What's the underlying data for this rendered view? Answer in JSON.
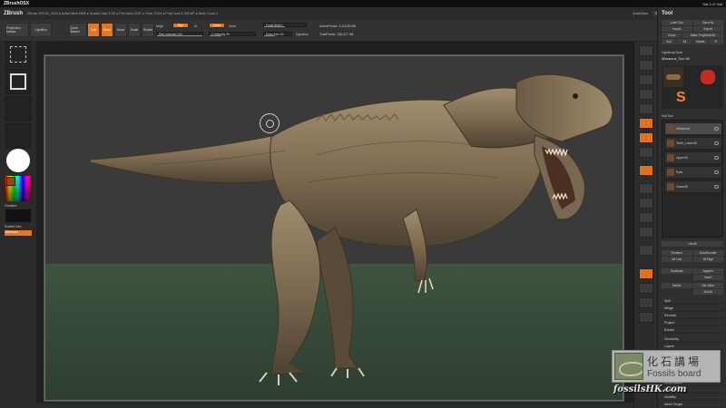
{
  "menubar": {
    "app": "ZBrushOSX",
    "clock": "Sat 2:47 AM"
  },
  "zmenu": {
    "brand": "ZBrush",
    "info": "ZBrush 4R6   Dz_1043   ● Active Mem 6958 ● Scratch Disk 3726 ● Free Mem 2257 ● Timer 0.004 ● PolyCount 4.788 MP ● Mesh Count 1",
    "quicksave": "QuickSave",
    "seethrough": "See-through 0",
    "menus": "Menus",
    "script": "DefaultZScript"
  },
  "shelf": {
    "projection_master": "Projection Master",
    "lightbox": "LightBox",
    "quick_sketch": "Quick Sketch",
    "edit": "Edit",
    "draw": "Draw",
    "move": "Move",
    "scale": "Scale",
    "rotate": "Rotate",
    "mrgb": "Mrgb",
    "rgb": "Rgb",
    "m": "M",
    "rgb_intensity": "Rgb Intensity 100",
    "zadd": "Zadd",
    "zsub": "Zsub",
    "z_intensity": "Z Intensity 25",
    "focal_shift": "Focal Shift 0",
    "draw_size": "Draw Size 64",
    "dynamic": "Dynamic",
    "active_points": "ActivePoints: 2,118,85 Mil",
    "total_points": "TotalPoints: 138,417 Mil"
  },
  "left": {
    "gradient": "Gradient",
    "switch_color": "SwitchColor",
    "alternate": "Alternate"
  },
  "palette": {
    "title": "Tool",
    "load_tool": "Load Tool",
    "save_as": "Save As",
    "import": "Import",
    "export": "Export",
    "clone": "Clone",
    "make_polymesh": "Make PolyMesh3D",
    "goz": "GoZ",
    "all": "All",
    "visible": "Visible",
    "r": "R",
    "lightbox_tools": "Lightbox▸Tools",
    "tool_name": "Allosaurus_Tool: 48",
    "thumb1": "Allosaurus",
    "thumb2": "PolyMesh3D",
    "thumb3": "SimpleBrush",
    "subtool_header": "SubTool",
    "subtools": [
      "Allosaurus",
      "Teeth_Lower48",
      "Upper48",
      "Eyes",
      "Claws48"
    ],
    "list_all": "List All",
    "rename": "Rename",
    "autoreorder": "AutoReorder",
    "all_low": "All Low",
    "all_high": "All High",
    "duplicate": "Duplicate",
    "append": "Append",
    "insert": "Insert",
    "delete": "Delete",
    "del_other": "Del Other",
    "del_all": "Del All",
    "split": "Split",
    "merge": "Merge",
    "remesh": "Remesh",
    "project": "Project",
    "extract": "Extract",
    "geometry": "Geometry",
    "layers": "Layers",
    "fibermesh": "FiberMesh",
    "geometry_hd": "Geometry HD",
    "preview": "Preview",
    "surface": "Surface",
    "deformation": "Deformation",
    "masking": "Masking",
    "visibility": "Visibility",
    "polygroups": "Polygroups",
    "mesh_target": "Mesh Target"
  },
  "watermark": {
    "cn": "化石講場",
    "en": "Fossils board",
    "url": "fossilsHK.com"
  },
  "colors": {
    "accent": "#e5751e",
    "bg": "#2f2f2f",
    "floor": "#3e5340"
  }
}
